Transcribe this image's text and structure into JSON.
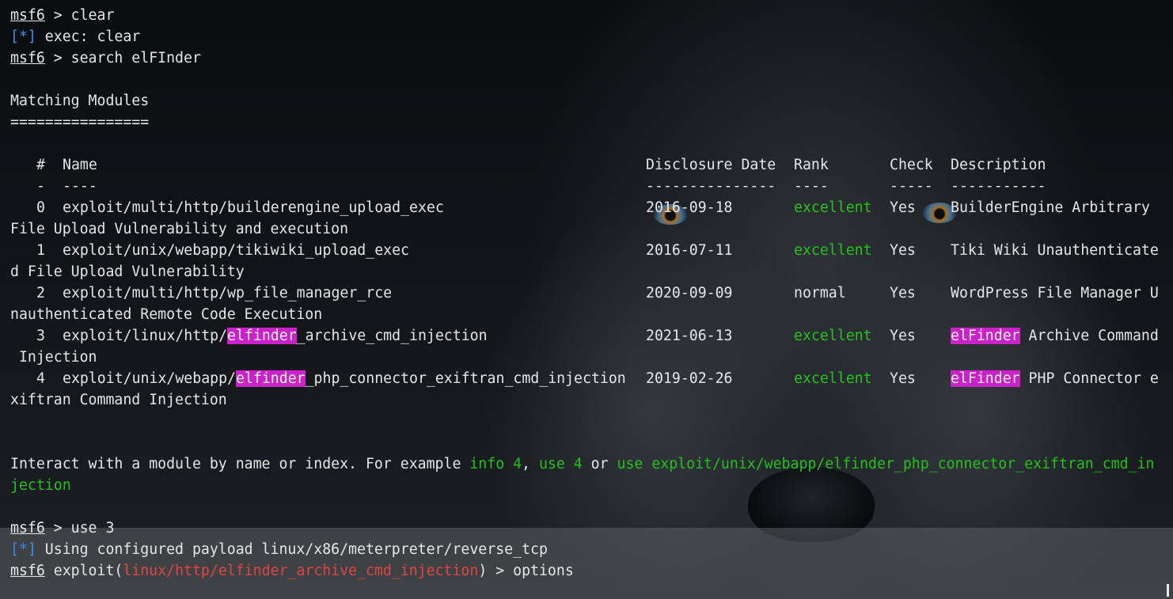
{
  "terminal": {
    "prompt": "msf6",
    "lines": {
      "cmd_clear": " > clear",
      "info_marker": "[*]",
      "exec_clear": " exec: clear",
      "cmd_search": " > search elFInder",
      "matching_title": "Matching Modules",
      "matching_rule": "================",
      "interact_prefix": "Interact with a module by name or index. For example ",
      "interact_info": "info 4",
      "interact_comma": ", ",
      "interact_use": "use 4",
      "interact_or": " or ",
      "interact_use_full_1": "use exploit/unix/webapp/elfinder_php_connector_exiftran_cmd_in",
      "interact_use_full_2": "jection",
      "cmd_use": " > use 3",
      "payload_msg": " Using configured payload linux/x86/meterpreter/reverse_tcp",
      "exploit_prefix": " exploit(",
      "exploit_module": "linux/http/elfinder_archive_cmd_injection",
      "exploit_suffix": ") > options"
    },
    "table": {
      "headers": {
        "num": "#",
        "name": "Name",
        "date": "Disclosure Date",
        "rank": "Rank",
        "check": "Check",
        "desc": "Description"
      },
      "underlines": {
        "num": "-",
        "name": "----",
        "date": "---------------",
        "rank": "----",
        "check": "-----",
        "desc": "-----------"
      },
      "rows": [
        {
          "num": "0",
          "name_pre": "exploit/multi/http/builderengine_upload_exec",
          "name_hl": "",
          "name_post": "",
          "date": "2016-09-18",
          "rank": "excellent",
          "check": "Yes",
          "desc_hl": "",
          "desc_line1": "BuilderEngine Arbitrary",
          "desc_line2": "File Upload Vulnerability and execution"
        },
        {
          "num": "1",
          "name_pre": "exploit/unix/webapp/tikiwiki_upload_exec",
          "name_hl": "",
          "name_post": "",
          "date": "2016-07-11",
          "rank": "excellent",
          "check": "Yes",
          "desc_hl": "",
          "desc_line1": "Tiki Wiki Unauthenticate",
          "desc_line2": "d File Upload Vulnerability"
        },
        {
          "num": "2",
          "name_pre": "exploit/multi/http/wp_file_manager_rce",
          "name_hl": "",
          "name_post": "",
          "date": "2020-09-09",
          "rank": "normal",
          "check": "Yes",
          "desc_hl": "",
          "desc_line1": "WordPress File Manager U",
          "desc_line2": "nauthenticated Remote Code Execution"
        },
        {
          "num": "3",
          "name_pre": "exploit/linux/http/",
          "name_hl": "elfinder",
          "name_post": "_archive_cmd_injection",
          "date": "2021-06-13",
          "rank": "excellent",
          "check": "Yes",
          "desc_hl": "elFinder",
          "desc_line1": " Archive Command",
          "desc_line2": " Injection"
        },
        {
          "num": "4",
          "name_pre": "exploit/unix/webapp/",
          "name_hl": "elfinder",
          "name_post": "_php_connector_exiftran_cmd_injection",
          "date": "2019-02-26",
          "rank": "excellent",
          "check": "Yes",
          "desc_hl": "elFinder",
          "desc_line1": " PHP Connector e",
          "desc_line2": "xiftran Command Injection"
        }
      ]
    }
  },
  "colors": {
    "text": "#e6e6e6",
    "info_marker": "#3b8eea",
    "rank_excellent": "#23c21b",
    "hint_green": "#23c21b",
    "module_red": "#e04444",
    "highlight": "#c822c8"
  }
}
